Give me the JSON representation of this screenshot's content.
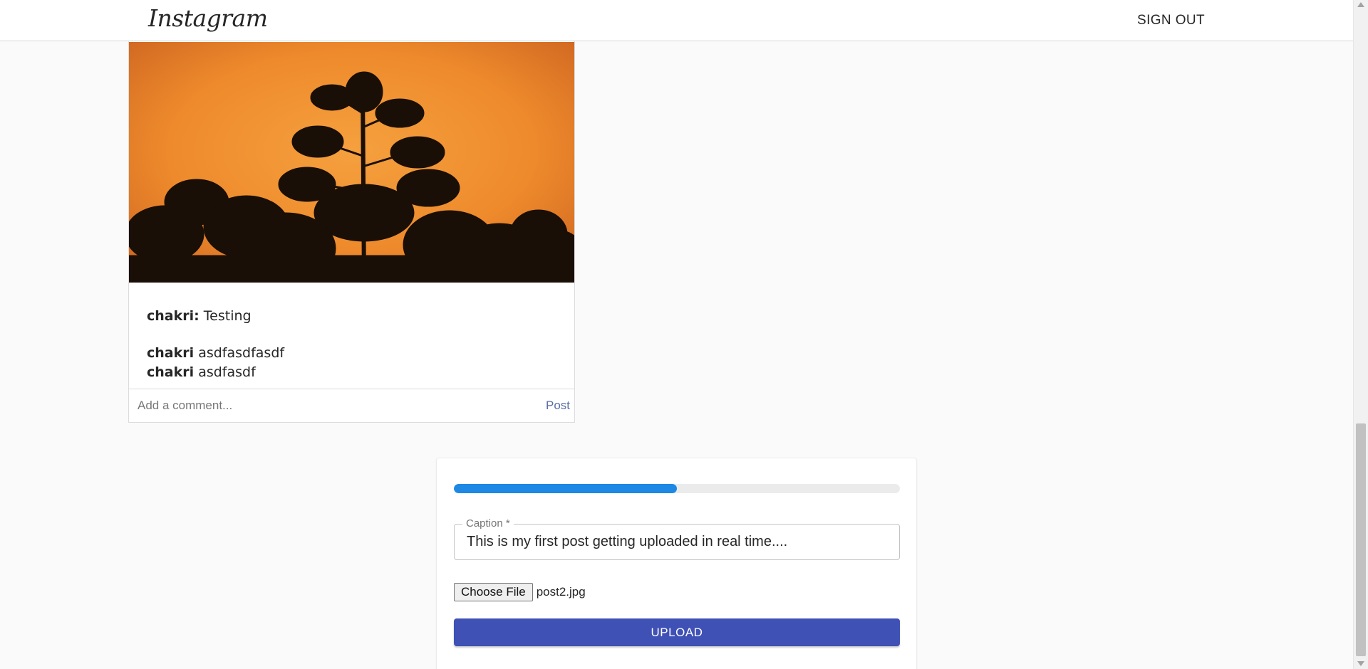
{
  "header": {
    "logo_text": "Instagram",
    "signout_label": "SIGN OUT"
  },
  "post": {
    "image_icon": "sunset-tree-silhouette-photo",
    "caption_user": "chakri:",
    "caption_text": "Testing",
    "comments": [
      {
        "user": "chakri",
        "text": "asdfasdfasdf"
      },
      {
        "user": "chakri",
        "text": "asdfasdf"
      }
    ],
    "comment_placeholder": "Add a comment...",
    "post_label": "Post"
  },
  "upload": {
    "progress_percent": 50,
    "caption_label": "Caption *",
    "caption_value": "This is my first post getting uploaded in real time....",
    "choose_file_label": "Choose File",
    "file_name": "post2.jpg",
    "upload_label": "UPLOAD"
  },
  "colors": {
    "progress": "#1e88e5",
    "upload_button": "#3f51b5",
    "post_link": "#5b6fa5"
  }
}
